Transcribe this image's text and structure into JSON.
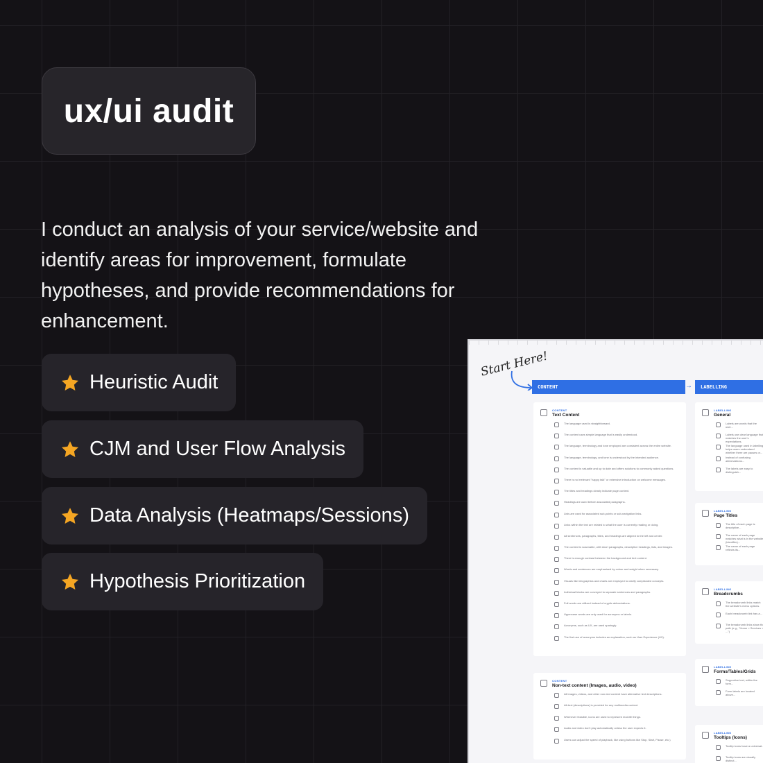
{
  "title": "ux/ui audit",
  "intro": "I conduct an analysis of your service/website and identify areas for improvement, formulate hypotheses, and provide recommendations for enhancement.",
  "services": [
    {
      "label": "Heuristic Audit",
      "icon": "star-icon"
    },
    {
      "label": "CJM and User Flow Analysis",
      "icon": "star-icon"
    },
    {
      "label": "Data Analysis (Heatmaps/Sessions)",
      "icon": "star-icon"
    },
    {
      "label": "Hypothesis Prioritization",
      "icon": "star-icon"
    }
  ],
  "colors": {
    "background": "#141216",
    "pill": "#27252a",
    "star": "#f5a623",
    "accent": "#2f6fe4"
  },
  "checklist": {
    "start_note": "Start Here!",
    "columns": [
      "CONTENT",
      "LABELLING"
    ],
    "cards": [
      {
        "tag": "CONTENT",
        "title": "Text Content",
        "items": [
          "The language used is straightforward.",
          "The content uses simple language that is easily understood.",
          "The language, terminology and tone employed are consistent across the entire website.",
          "The language, terminology, and tone is understood by the intended audience.",
          "The content is valuable and up to date and offers solutions to commonly asked questions.",
          "There is no irrelevant \"happy talk\" or extensive introduction on welcome messages.",
          "The titles and headings clearly indicate page content.",
          "Headings are used before associated paragraphs.",
          "Lists are used for associated sub-points or sub-navigation links.",
          "Links within the text are related to what the user is currently reading or doing.",
          "All sentences, paragraphs, titles, and headings are aligned to the left and center.",
          "The content is scannable, with short paragraphs, descriptive headings, lists, and images.",
          "There is enough contrast between the background and text content.",
          "Words and sentences are emphasized by colour and weight when necessary.",
          "Visuals like infographics and charts are employed to clarify complicated concepts.",
          "Individual blocks are conveyed to separate sentences and paragraphs.",
          "Full words are utilized instead of cryptic abbreviations.",
          "Uppercase words are only used for acronyms or labels.",
          "Acronyms, such as UX, are used sparingly.",
          "The first use of acronyms includes an explanation, such as User Experience (UX)."
        ]
      },
      {
        "tag": "CONTENT",
        "title": "Non-text content (Images, audio, video)",
        "items": [
          "All images, videos, and other non-text content have alternative text descriptions.",
          "Alt-text (descriptions) is provided for any multimedia content.",
          "Whenever feasible, icons are used to represent real-life things.",
          "Audio and video don't play automatically unless the user expects it.",
          "Users can adjust the speed of playback, like using buttons like Stop, Start, Pause, etc.)"
        ]
      },
      {
        "tag": "LABELLING",
        "title": "General",
        "items": [
          "Labels are words that the user...",
          "Labels use clear language that matches the user's expectations.",
          "The language used in labelling helps users understand whether there are pauses or...",
          "Instead of confusing abbreviations...",
          "The labels are easy to distinguish..."
        ]
      },
      {
        "tag": "LABELLING",
        "title": "Page Titles",
        "items": [
          "The title of each page is descriptive...",
          "The name of each page matches what is in the website (identifier)...",
          "The name of each page reflects its..."
        ]
      },
      {
        "tag": "LABELLING",
        "title": "Breadcrumbs",
        "items": [
          "The breadcrumb links match the website's menu options.",
          "Each breadcrumb link has a...",
          "The breadcrumb links show the path (e.g., \"Home > Services > ...\")"
        ]
      },
      {
        "tag": "LABELLING",
        "title": "Forms/Tables/Grids",
        "items": [
          "Supportive text, within the form...",
          "Form labels are located above..."
        ]
      },
      {
        "tag": "LABELLING",
        "title": "Tooltips (Icons)",
        "items": [
          "Tooltip icons have a universal...",
          "Tooltip icons are visually distinct..."
        ]
      }
    ]
  }
}
